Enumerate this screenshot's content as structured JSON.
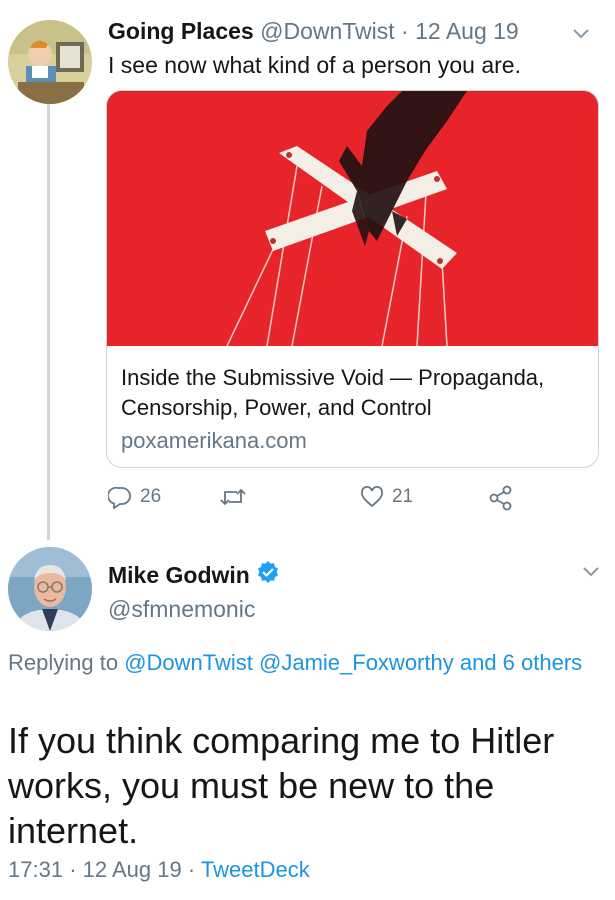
{
  "tweet1": {
    "display_name": "Going Places",
    "handle": "@DownTwist",
    "separator": "·",
    "date": "12 Aug 19",
    "text": "I see now what kind of a person you are.",
    "card": {
      "title": "Inside the Submissive Void — Propaganda, Censorship, Power, and Control",
      "domain": "poxamerikana.com"
    },
    "actions": {
      "reply_count": "26",
      "retweet_count": "",
      "like_count": "21"
    }
  },
  "tweet2": {
    "display_name": "Mike Godwin",
    "handle": "@sfmnemonic",
    "replying_prefix": "Replying to",
    "replying_to": "@DownTwist @Jamie_Foxworthy",
    "replying_suffix": "and 6 others",
    "text": "If you think comparing me to Hitler works, you must be new to the internet.",
    "time": "17:31",
    "separator": "·",
    "date": "12 Aug 19",
    "source": "TweetDeck"
  },
  "colors": {
    "link": "#1b95e0",
    "muted": "#657786",
    "card_bg": "#e8242b",
    "verified": "#1da1f2"
  }
}
